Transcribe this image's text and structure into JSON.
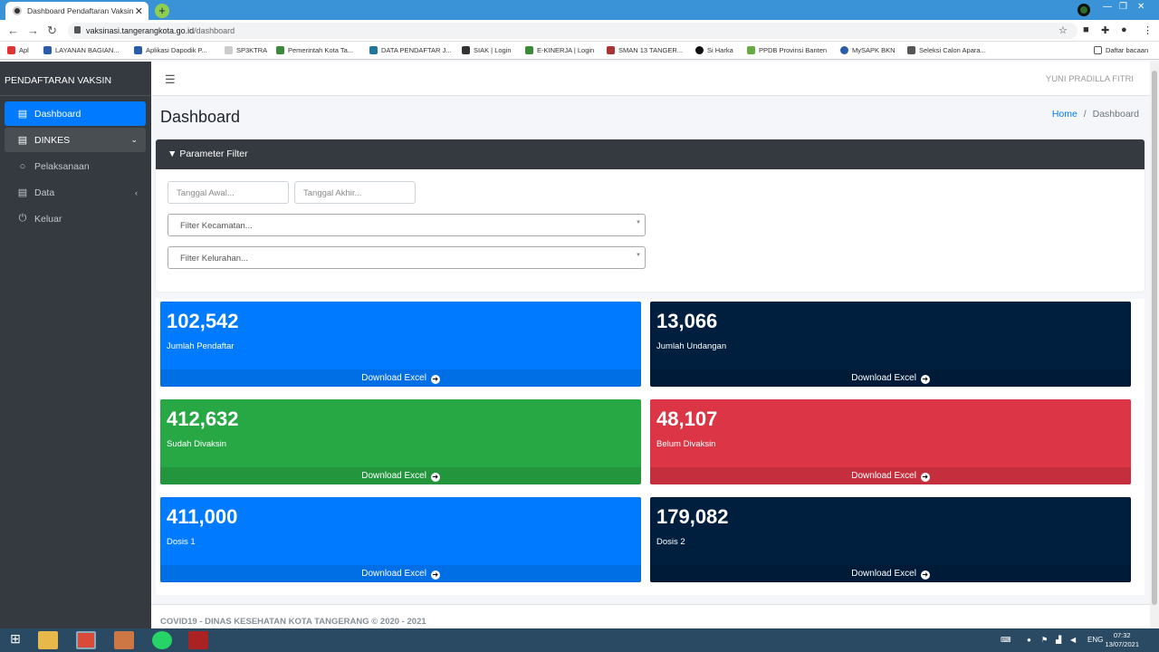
{
  "browser": {
    "tab_title": "Dashboard Pendaftaran Vaksin",
    "url_host": "vaksinasi.tangerangkota.go.id",
    "url_path": "/dashboard",
    "bookmarks": [
      "Apl",
      "LAYANAN BAGIAN...",
      "Aplikasi Dapodik P...",
      "SP3KTRA",
      "Pemerintah Kota Ta...",
      "DATA PENDAFTAR J...",
      "SIAK | Login",
      "E-KINERJA | Login",
      "SMAN 13 TANGER...",
      "Si Harka",
      "PPDB Provinsi Banten",
      "MySAPK BKN",
      "Seleksi Calon Apara...",
      "Daftar bacaan"
    ]
  },
  "sidebar": {
    "brand": "PENDAFTARAN VAKSIN",
    "items": [
      {
        "label": "Dashboard"
      },
      {
        "label": "DINKES"
      },
      {
        "label": "Pelaksanaan"
      },
      {
        "label": "Data"
      },
      {
        "label": "Keluar"
      }
    ]
  },
  "header": {
    "user": "YUNI PRADILLA FITRI"
  },
  "page": {
    "title": "Dashboard",
    "breadcrumb_home": "Home",
    "breadcrumb_sep": "/",
    "breadcrumb_current": "Dashboard"
  },
  "filter": {
    "title": "Parameter Filter",
    "date_start_placeholder": "Tanggal Awal...",
    "date_end_placeholder": "Tanggal Akhir...",
    "kecamatan_placeholder": "Filter Kecamatan...",
    "kelurahan_placeholder": "Filter Kelurahan..."
  },
  "stats": [
    {
      "value": "102,542",
      "label": "Jumlah Pendaftar",
      "action": "Download Excel",
      "color": "#007bff"
    },
    {
      "value": "13,066",
      "label": "Jumlah Undangan",
      "action": "Download Excel",
      "color": "#001f3f"
    },
    {
      "value": "412,632",
      "label": "Sudah Divaksin",
      "action": "Download Excel",
      "color": "#28a745"
    },
    {
      "value": "48,107",
      "label": "Belum Divaksin",
      "action": "Download Excel",
      "color": "#dc3545"
    },
    {
      "value": "411,000",
      "label": "Dosis 1",
      "action": "Download Excel",
      "color": "#007bff"
    },
    {
      "value": "179,082",
      "label": "Dosis 2",
      "action": "Download Excel",
      "color": "#001f3f"
    }
  ],
  "footer": {
    "text": "COVID19 - DINAS KESEHATAN KOTA TANGERANG © 2020 - 2021"
  },
  "taskbar": {
    "lang": "ENG",
    "time": "07:32",
    "date": "13/07/2021"
  }
}
